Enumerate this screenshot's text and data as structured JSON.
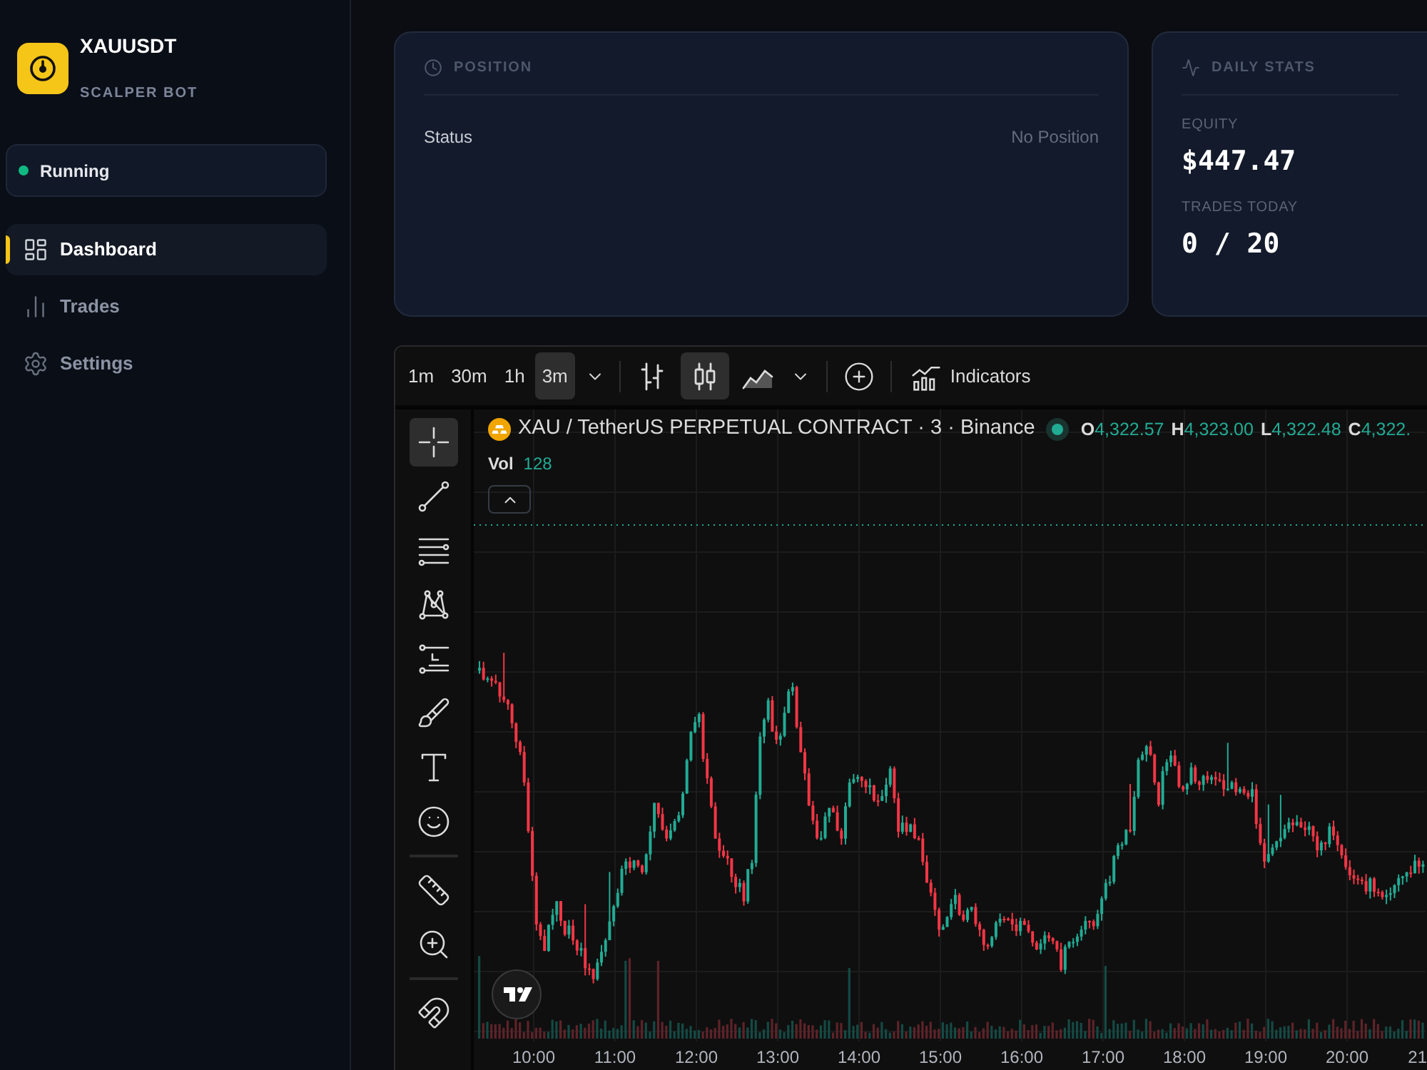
{
  "sidebar": {
    "brand": {
      "title": "XAUUSDT",
      "subtitle": "SCALPER BOT"
    },
    "status": {
      "label": "Running",
      "on": true
    },
    "nav": [
      {
        "kind": "dashboard",
        "label": "Dashboard",
        "selected": true
      },
      {
        "kind": "trades",
        "label": "Trades",
        "selected": false
      },
      {
        "kind": "settings",
        "label": "Settings",
        "selected": false
      }
    ]
  },
  "cards": [
    {
      "kind": "position",
      "title": "POSITION",
      "rows": [
        {
          "label": "Status",
          "value": "No Position"
        }
      ]
    },
    {
      "kind": "stats",
      "title": "DAILY STATS",
      "stats": [
        {
          "label": "EQUITY",
          "value": "$447.47"
        },
        {
          "label": "TRADES TODAY",
          "value": "0 / 20"
        }
      ]
    }
  ],
  "chart": {
    "toolbar": {
      "intervals": [
        {
          "label": "1m",
          "selected": false
        },
        {
          "label": "30m",
          "selected": false
        },
        {
          "label": "1h",
          "selected": false
        },
        {
          "label": "3m",
          "selected": true
        }
      ],
      "chart_types": [
        {
          "kind": "bars",
          "selected": false
        },
        {
          "kind": "candles",
          "selected": true
        },
        {
          "kind": "area",
          "selected": false
        }
      ],
      "indicators": "Indicators"
    },
    "tool_groups": [
      {
        "tools": [
          {
            "kind": "crosshair",
            "selected": true
          },
          {
            "kind": "trendline",
            "selected": false
          },
          {
            "kind": "hlines",
            "selected": false
          },
          {
            "kind": "pattern",
            "selected": false
          },
          {
            "kind": "fib",
            "selected": false
          },
          {
            "kind": "brush",
            "selected": false
          },
          {
            "kind": "text",
            "selected": false
          },
          {
            "kind": "emoji",
            "selected": false
          }
        ]
      },
      {
        "tools": [
          {
            "kind": "ruler",
            "selected": false
          },
          {
            "kind": "zoom",
            "selected": false
          }
        ]
      },
      {
        "tools": [
          {
            "kind": "magnet",
            "selected": false
          }
        ]
      }
    ],
    "legend": {
      "symbol": "XAU / TetherUS PERPETUAL CONTRACT · 3 · Binance",
      "market_open": true,
      "rising": true,
      "ohlc": [
        {
          "key": "O",
          "value": "4,322.57"
        },
        {
          "key": "H",
          "value": "4,323.00"
        },
        {
          "key": "L",
          "value": "4,322.48"
        },
        {
          "key": "C",
          "value": "4,322."
        }
      ],
      "volume": {
        "label": "Vol",
        "value": "128"
      }
    },
    "time_labels": [
      "10:00",
      "11:00",
      "12:00",
      "13:00",
      "14:00",
      "15:00",
      "16:00",
      "17:00",
      "18:00",
      "19:00",
      "20:00",
      "21"
    ]
  }
}
